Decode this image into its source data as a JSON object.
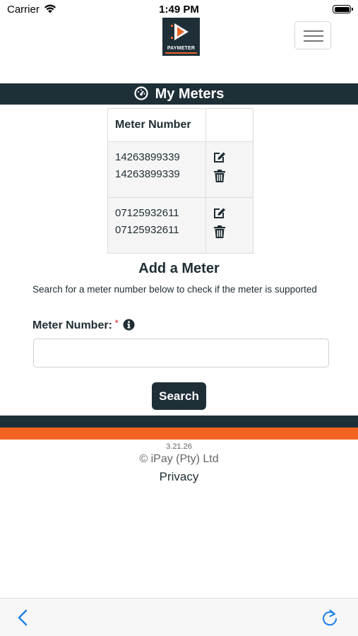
{
  "status_bar": {
    "carrier": "Carrier",
    "time": "1:49 PM"
  },
  "header": {
    "logo_text": "PAYMETER",
    "title": "My Meters"
  },
  "meters_table": {
    "column_header": "Meter Number",
    "rows": [
      {
        "line1": "14263899339",
        "line2": "14263899339"
      },
      {
        "line1": "07125932611",
        "line2": "07125932611"
      }
    ]
  },
  "add_meter": {
    "title": "Add a Meter",
    "description": "Search for a meter number below to check if the meter is supported",
    "field_label": "Meter Number:",
    "required_mark": "*",
    "input_value": "",
    "search_label": "Search"
  },
  "footer": {
    "version": "3.21.26",
    "copyright": "© iPay (Pty) Ltd",
    "privacy": "Privacy"
  },
  "colors": {
    "dark": "#1f2f38",
    "orange": "#f26322",
    "link_blue": "#1a7fe6"
  },
  "icons": [
    "wifi-icon",
    "battery-icon",
    "menu-icon",
    "gauge-icon",
    "edit-icon",
    "trash-icon",
    "info-icon",
    "back-icon",
    "reload-icon"
  ]
}
